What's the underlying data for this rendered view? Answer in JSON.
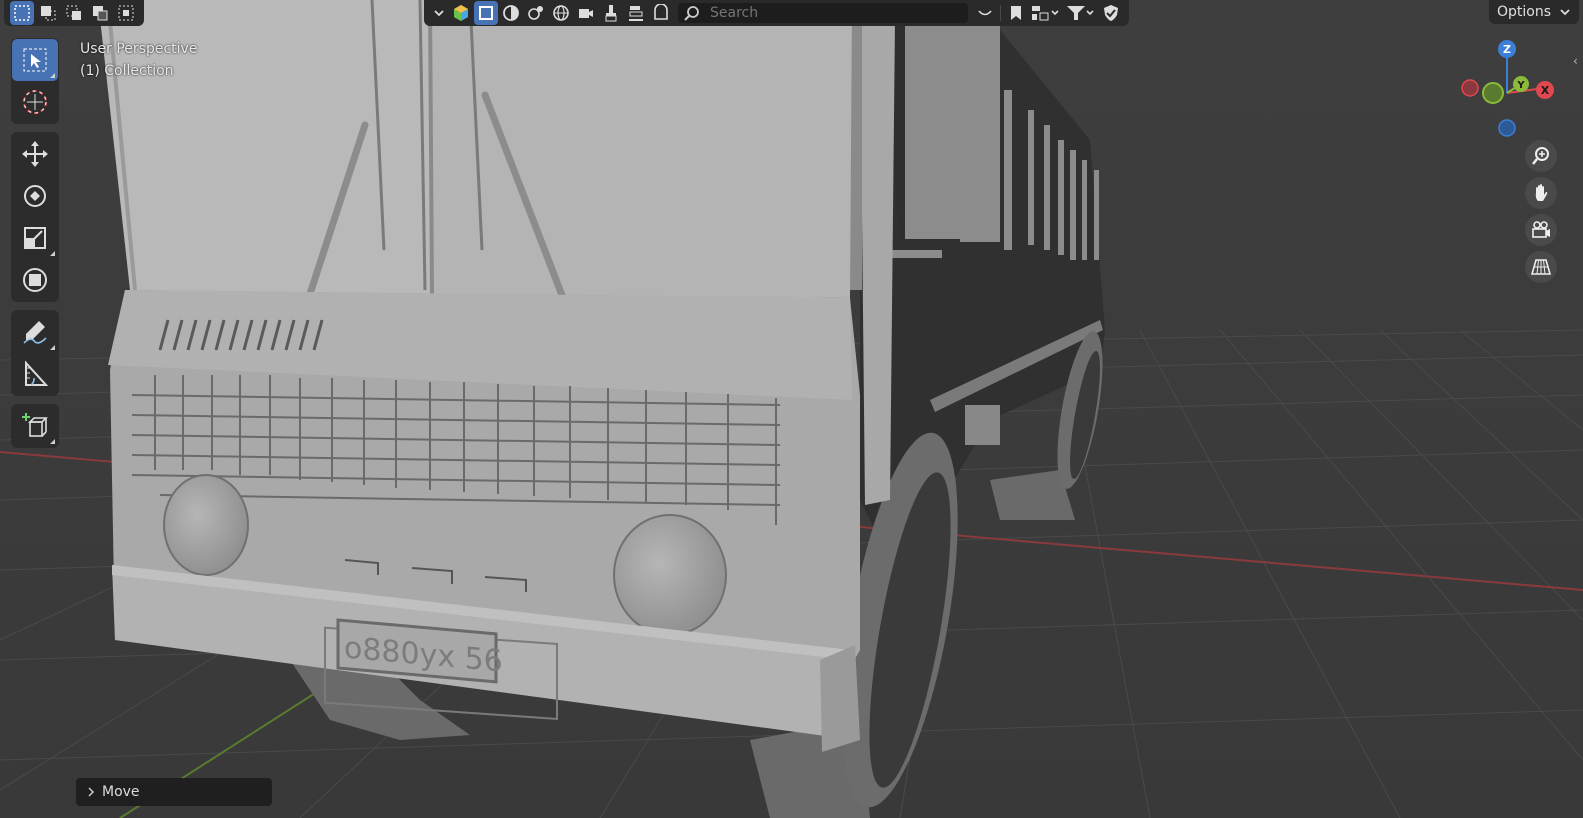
{
  "header": {
    "search_placeholder": "Search",
    "options_label": "Options"
  },
  "viewport": {
    "view_name": "User Perspective",
    "collection": "(1) Collection",
    "plate_text": "o880yx 56"
  },
  "gizmo": {
    "z_label": "Z",
    "y_label": "Y",
    "x_label": "X"
  },
  "operator_panel": {
    "label": "Move"
  },
  "colors": {
    "accent": "#4772b3",
    "axis_x": "#e0474f",
    "axis_y": "#8bba3a",
    "axis_z": "#3c7fd6"
  }
}
